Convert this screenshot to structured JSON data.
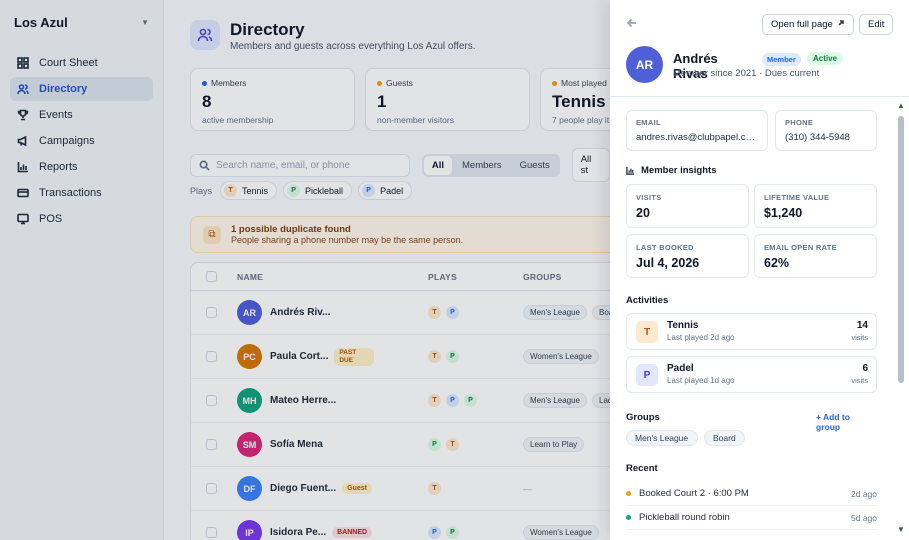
{
  "sidebar": {
    "org_name": "Los Azul",
    "items": [
      {
        "label": "Court Sheet",
        "icon": "grid-icon"
      },
      {
        "label": "Directory",
        "icon": "users-icon"
      },
      {
        "label": "Events",
        "icon": "trophy-icon"
      },
      {
        "label": "Campaigns",
        "icon": "megaphone-icon"
      },
      {
        "label": "Reports",
        "icon": "bar-chart-icon"
      },
      {
        "label": "Transactions",
        "icon": "credit-card-icon"
      },
      {
        "label": "POS",
        "icon": "monitor-icon"
      }
    ],
    "active": "Directory"
  },
  "header": {
    "title": "Directory",
    "subtitle": "Members and guests across everything Los Azul offers."
  },
  "stats": [
    {
      "label": "Members",
      "value": "8",
      "sub": "active membership",
      "color": "#2563eb"
    },
    {
      "label": "Guests",
      "value": "1",
      "sub": "non-member visitors",
      "color": "#f59e0b"
    },
    {
      "label": "Most played",
      "value": "Tennis",
      "sub": "7 people play it",
      "color": "#f59e0b"
    }
  ],
  "filters": {
    "search_placeholder": "Search name, email, or phone",
    "segments": [
      "All",
      "Members",
      "Guests"
    ],
    "status": "All st",
    "plays_label": "Plays",
    "plays": [
      {
        "letter": "T",
        "label": "Tennis"
      },
      {
        "letter": "P",
        "label": "Pickleball"
      },
      {
        "letter": "P",
        "label": "Padel"
      }
    ]
  },
  "duplicate": {
    "title": "1 possible duplicate found",
    "sub": "People sharing a phone number may be the same person."
  },
  "table": {
    "headers": {
      "name": "NAME",
      "plays": "PLAYS",
      "groups": "GROUPS"
    },
    "rows": [
      {
        "initials": "AR",
        "name": "Andrés Riv...",
        "color": "#4f5fd8",
        "badge": "",
        "plays": [
          "T",
          "P"
        ],
        "groups": [
          "Men's League",
          "Boa"
        ]
      },
      {
        "initials": "PC",
        "name": "Paula Cort...",
        "color": "#d97706",
        "badge": "PAST DUE",
        "plays": [
          "T",
          "P"
        ],
        "groups": [
          "Women's League"
        ]
      },
      {
        "initials": "MH",
        "name": "Mateo Herre...",
        "color": "#10a37f",
        "badge": "",
        "plays": [
          "T",
          "P",
          "P"
        ],
        "groups": [
          "Men's League",
          "Lad"
        ]
      },
      {
        "initials": "SM",
        "name": "Sofía Mena",
        "color": "#db2777",
        "badge": "",
        "plays": [
          "P",
          "T"
        ],
        "groups": [
          "Learn to Play"
        ]
      },
      {
        "initials": "DF",
        "name": "Diego Fuent...",
        "color": "#3b82f6",
        "badge": "Guest",
        "plays": [
          "T"
        ],
        "groups": []
      },
      {
        "initials": "IP",
        "name": "Isidora Pe...",
        "color": "#7c3aed",
        "badge": "BANNED",
        "plays": [
          "P",
          "P"
        ],
        "groups": [
          "Women's League"
        ]
      }
    ],
    "empty_groups": "—"
  },
  "drawer": {
    "full_page_label": "Open full page",
    "edit_label": "Edit",
    "initials": "AR",
    "name": "Andrés Rivas",
    "member_badge": "Member",
    "status_badge": "Active",
    "since": "Member since 2021 · Dues current",
    "email_label": "EMAIL",
    "email": "andres.rivas@clubpapel.co...",
    "phone_label": "PHONE",
    "phone": "(310) 344-5948",
    "insights_title": "Member insights",
    "metrics": [
      {
        "label": "VISITS",
        "value": "20"
      },
      {
        "label": "LIFETIME VALUE",
        "value": "$1,240"
      },
      {
        "label": "LAST BOOKED",
        "value": "Jul 4, 2026"
      },
      {
        "label": "EMAIL OPEN RATE",
        "value": "62%"
      }
    ],
    "activities_title": "Activities",
    "activities": [
      {
        "letter": "T",
        "name": "Tennis",
        "sub": "Last played 2d ago",
        "count": "14",
        "unit": "visits"
      },
      {
        "letter": "P",
        "name": "Padel",
        "sub": "Last played 1d ago",
        "count": "6",
        "unit": "visits"
      }
    ],
    "groups_title": "Groups",
    "add_group": "+ Add to group",
    "groups": [
      "Men's League",
      "Board"
    ],
    "recent_title": "Recent",
    "recent": [
      {
        "text": "Booked Court 2 · 6:00 PM",
        "time": "2d ago",
        "color": "#f59e0b"
      },
      {
        "text": "Pickleball round robin",
        "time": "5d ago",
        "color": "#10a37f"
      }
    ]
  }
}
